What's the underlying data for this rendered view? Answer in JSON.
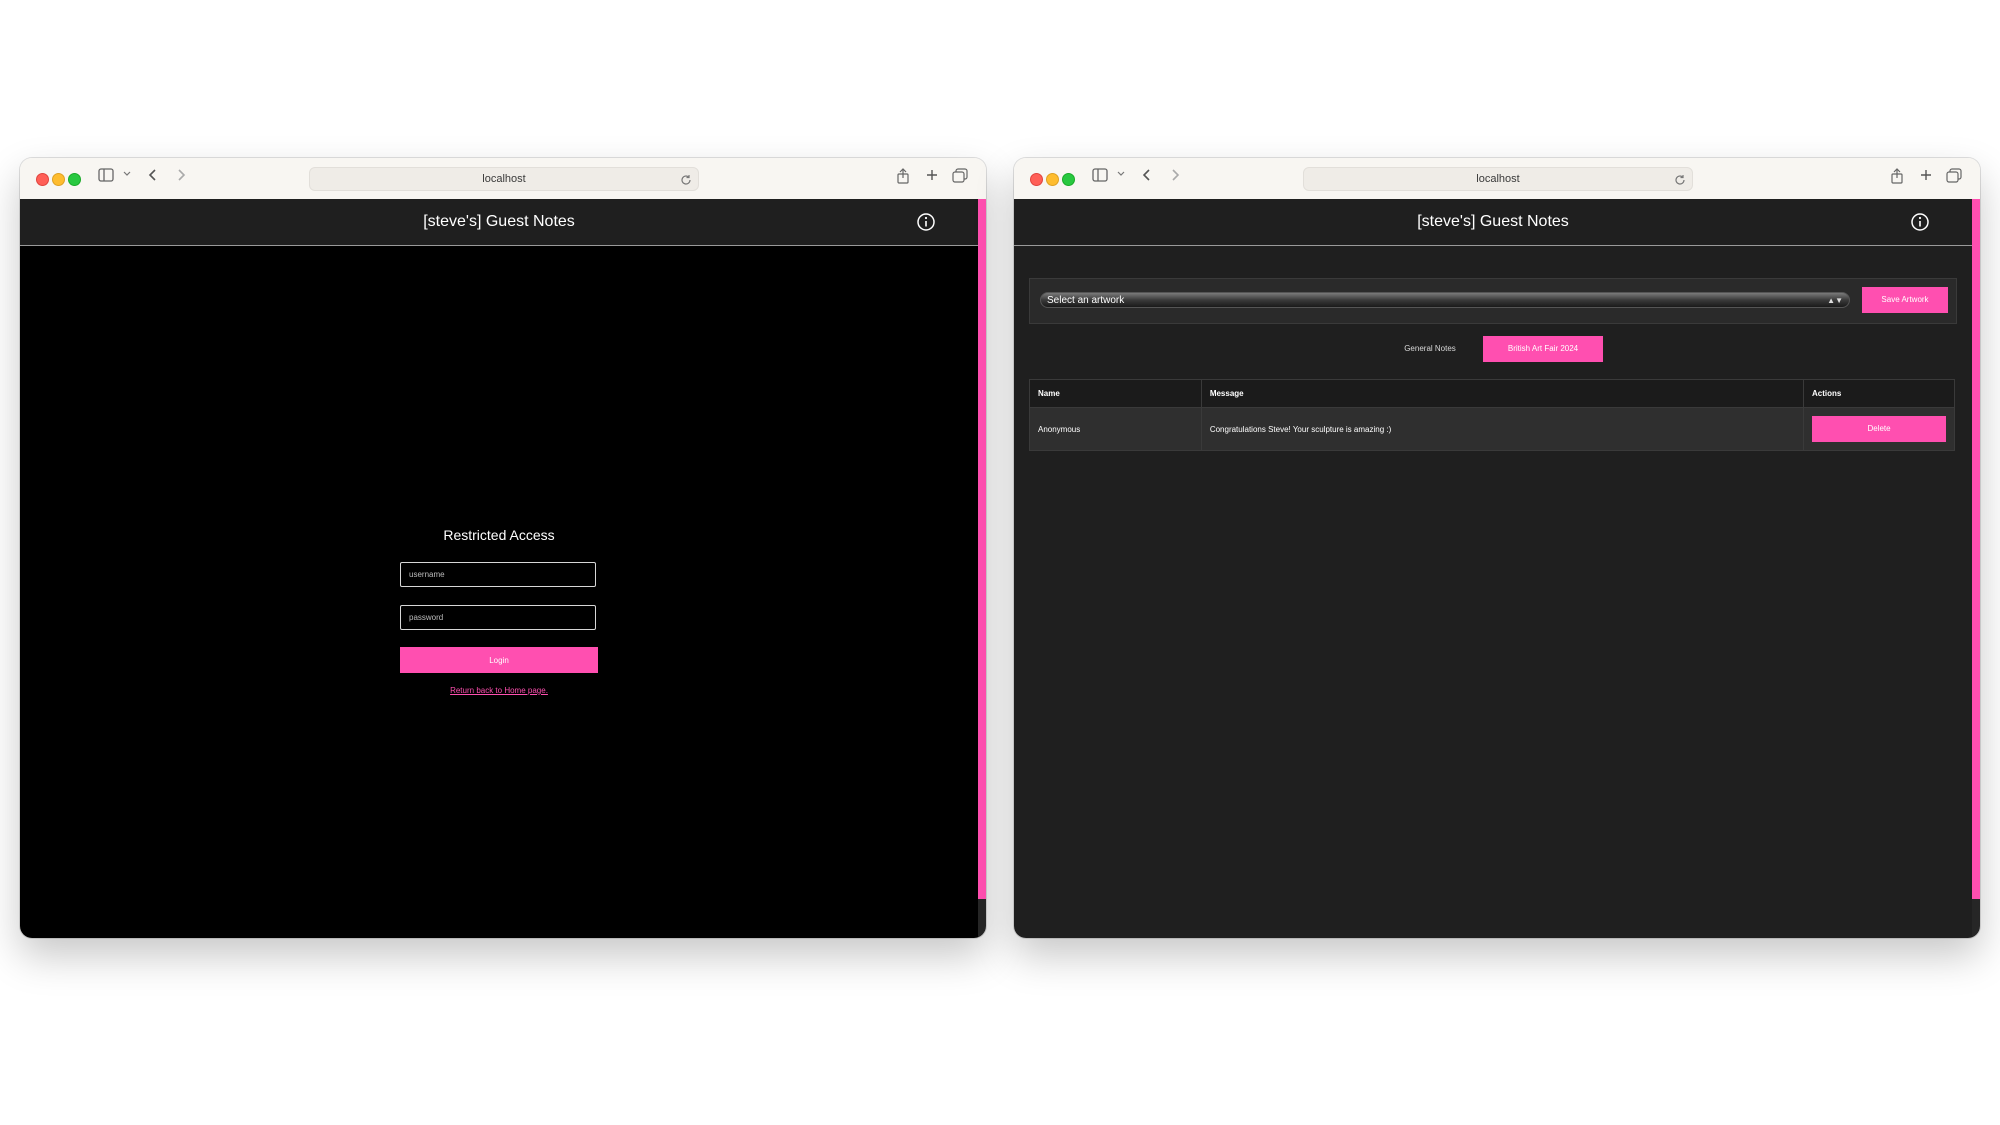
{
  "browser": {
    "address": "localhost"
  },
  "app": {
    "title": "[steve's] Guest Notes"
  },
  "login": {
    "heading": "Restricted Access",
    "username_placeholder": "username",
    "password_placeholder": "password",
    "login_label": "Login",
    "home_link": "Return back to Home page."
  },
  "notes": {
    "select_placeholder": "Select an artwork",
    "save_label": "Save Artwork",
    "tabs": [
      {
        "label": "General Notes",
        "active": false
      },
      {
        "label": "British Art Fair 2024",
        "active": true
      }
    ],
    "columns": [
      "Name",
      "Message",
      "Actions"
    ],
    "rows": [
      {
        "name": "Anonymous",
        "message": "Congratulations Steve! Your sculpture is amazing :)",
        "action": "Delete"
      }
    ]
  },
  "colors": {
    "accent": "#ff4fb0",
    "header_bg": "#1f1f1f",
    "login_bg": "#000000"
  },
  "icons": [
    "sidebar-icon",
    "chevron-down-icon",
    "back-icon",
    "forward-icon",
    "reload-icon",
    "share-icon",
    "new-tab-icon",
    "tabs-overview-icon",
    "info-icon"
  ]
}
